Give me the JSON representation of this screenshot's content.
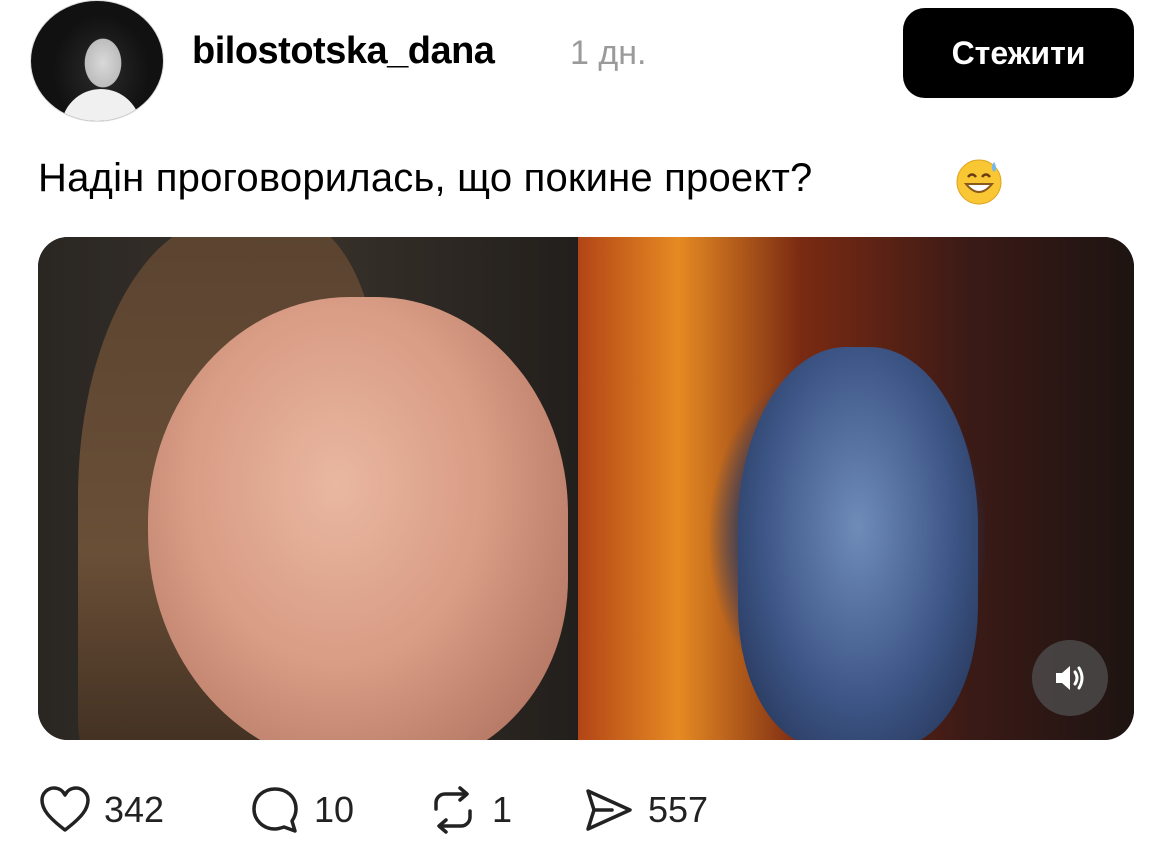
{
  "post": {
    "username": "bilostotska_dana",
    "time": "1 дн.",
    "follow_label": "Стежити",
    "text": "Надін проговорилась, що покине проект?",
    "emoji": "grinning-sweat-emoji"
  },
  "media": {
    "sound_icon": "speaker-icon"
  },
  "actions": {
    "likes": "342",
    "comments": "10",
    "reposts": "1",
    "shares": "557"
  },
  "colors": {
    "accent": "#000000",
    "muted": "#9a9a9a"
  }
}
